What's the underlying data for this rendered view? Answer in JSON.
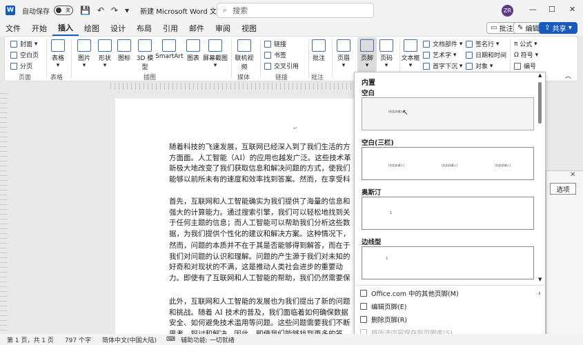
{
  "titlebar": {
    "autosave_label": "自动保存",
    "autosave_state": "关",
    "doc_title": "新建 Microsoft Word 文档",
    "search_placeholder": "搜索",
    "avatar_initials": "ZR",
    "minimize": "—",
    "maximize": "☐",
    "close": "✕"
  },
  "menu": {
    "tabs": [
      "文件",
      "开始",
      "插入",
      "绘图",
      "设计",
      "布局",
      "引用",
      "邮件",
      "审阅",
      "视图"
    ],
    "active": "插入",
    "comments_label": "批注",
    "editing_label": "编辑",
    "share_label": "共享"
  },
  "ribbon": {
    "pages": {
      "cover": "封面",
      "blank": "空白页",
      "break": "分页",
      "label": "页面"
    },
    "table": {
      "table": "表格",
      "label": "表格"
    },
    "illustrations": {
      "picture": "图片",
      "shape": "形状",
      "icons": "图标",
      "model3d": "3D 模型",
      "smartart": "SmartArt",
      "chart": "图表",
      "screenshot": "屏幕截图",
      "label": "插图"
    },
    "media": {
      "video": "联机视频",
      "label": "媒体"
    },
    "links": {
      "link": "链接",
      "bookmark": "书签",
      "crossref": "交叉引用",
      "label": "链接"
    },
    "comments": {
      "comment": "批注",
      "label": "批注"
    },
    "header_footer": {
      "header": "页眉",
      "footer": "页脚",
      "pagenum": "页码"
    },
    "text": {
      "textbox": "文本框",
      "quickparts": "文档部件",
      "wordart": "艺术字",
      "dropcap": "首字下沉",
      "signature": "签名行",
      "datetime": "日期和时间",
      "object": "对象"
    },
    "symbols": {
      "equation": "公式",
      "symbol": "符号",
      "number": "编号"
    }
  },
  "document": {
    "paragraphs": [
      "随着科技的飞速发展，互联网已经深入到了我们生活的方方面面。人工智能（AI）的应用也越发广泛。这些技术革新极大地改变了我们获取信息和解决问题的方式，使我们能够以前所未有的速度和效率找到答案。然而，在享受科技带来的便利时，不禁要问：我们的问题是否会因为答案的增多而越来越少呢？↵",
      "首先，互联网和人工智能确实为我们提供了海量的信息和强大的计算能力。通过搜索引擎，我们可以轻松地找到关于任何主题的信息；而人工智能可以帮助我们分析这些数据，为我们提供个性化的建议和解决方案。这种情况下，我们解决问题时更加高效，但同时也可能导致我们减少了对问题的思考。↵",
      "然而，问题的本质并不在于其是否能够得到解答，而在于我们对问题的认识和理解。问题的产生源于我们对未知的好奇和对现状的不满，这是推动人类社会进步的重要动力。即使有了互联网和人工智能的帮助，我们仍然需要保持对问题的敏感性和探索精神。因为只有这样，我们才能不断地发现问题、解决问题，推动社会向前发展。↵",
      "此外，互联网和人工智能的发展也为我们提出了新的问题和挑战。随着 AI 技术的普及，我们面临着如何确保数据安全、如何避免技术滥用等问题。这些问题需要我们不断思考、探讨和解决。因此，即使我们能够找到更多的答案，我们仍然需要不断地提出新问题、思考问题。↵"
    ]
  },
  "footer_gallery": {
    "section_title": "内置",
    "items": [
      {
        "name": "空白",
        "preview": "[在此处键入]"
      },
      {
        "name": "空白(三栏)",
        "preview": "[在此处键入]"
      },
      {
        "name": "奥斯汀",
        "preview": "1"
      },
      {
        "name": "边线型",
        "preview": "1"
      }
    ],
    "more_link": "Office.com 中的其他页脚(M)",
    "edit": "编辑页脚(E)",
    "remove": "删除页脚(R)",
    "save": "将所选内容保存到页脚库(S)..."
  },
  "side_panel": {
    "options_label": "选项"
  },
  "statusbar": {
    "page": "第 1 页，共 1 页",
    "words": "797 个字",
    "language": "简体中文(中国大陆)",
    "accessibility": "辅助功能: 一切就绪"
  }
}
